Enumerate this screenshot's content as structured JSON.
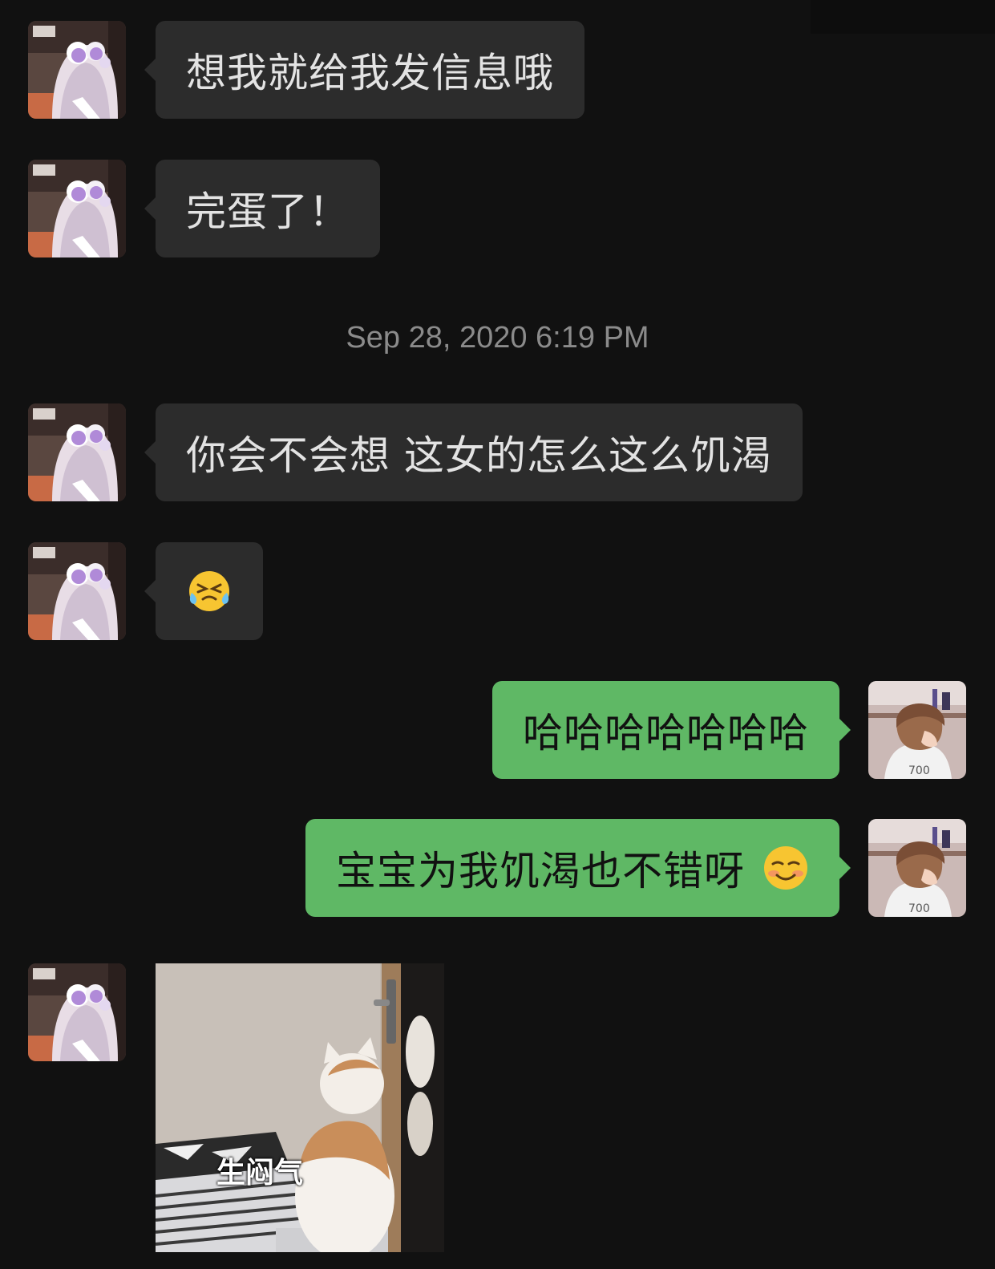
{
  "timestamp": "Sep 28, 2020 6:19 PM",
  "messages": [
    {
      "text": "想我就给我发信息哦"
    },
    {
      "text": "完蛋了！"
    },
    {
      "text": "你会不会想 这女的怎么这么饥渴"
    },
    {
      "text": "",
      "emoji": "crying-laughing-face-emoji"
    },
    {
      "text": "哈哈哈哈哈哈哈"
    },
    {
      "text": "宝宝为我饥渴也不错呀",
      "emoji": "smiling-face-emoji"
    }
  ],
  "sticker": {
    "caption": "生闷气",
    "subject": "cat-facing-door"
  },
  "colors": {
    "background": "#111111",
    "incoming_bubble": "#2c2c2c",
    "outgoing_bubble": "#5fb865",
    "timestamp": "#8b8b8b"
  }
}
